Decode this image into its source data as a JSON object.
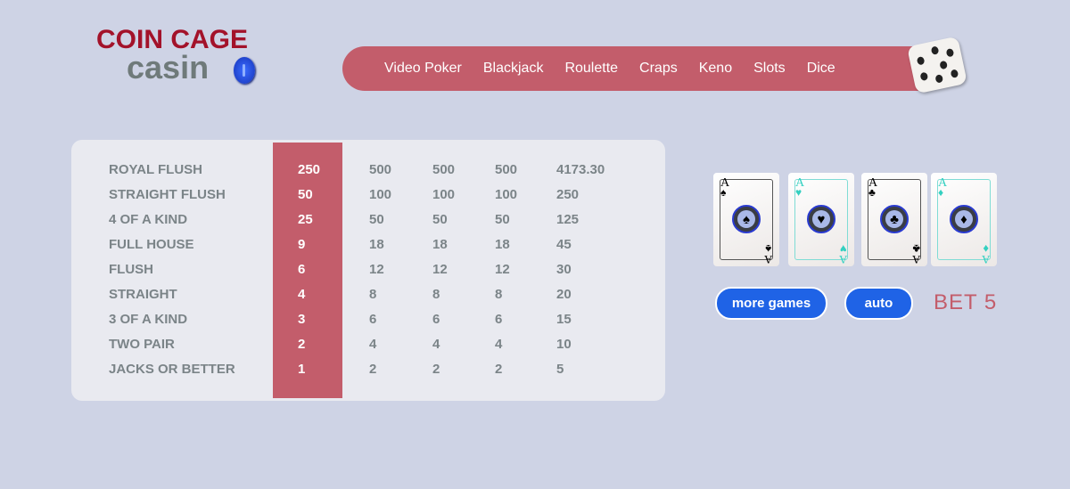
{
  "logo": {
    "line1": "COIN CAGE",
    "line2": "casin"
  },
  "nav": [
    "Video Poker",
    "Blackjack",
    "Roulette",
    "Craps",
    "Keno",
    "Slots",
    "Dice"
  ],
  "paytable": [
    [
      "ROYAL FLUSH",
      "250",
      "500",
      "500",
      "500",
      "4173.30"
    ],
    [
      "STRAIGHT FLUSH",
      "50",
      "100",
      "100",
      "100",
      "250"
    ],
    [
      "4 OF A KIND",
      "25",
      "50",
      "50",
      "50",
      "125"
    ],
    [
      "FULL HOUSE",
      "9",
      "18",
      "18",
      "18",
      "45"
    ],
    [
      "FLUSH",
      "6",
      "12",
      "12",
      "12",
      "30"
    ],
    [
      "STRAIGHT",
      "4",
      "8",
      "8",
      "8",
      "20"
    ],
    [
      "3 OF A KIND",
      "3",
      "6",
      "6",
      "6",
      "15"
    ],
    [
      "TWO PAIR",
      "2",
      "4",
      "4",
      "4",
      "10"
    ],
    [
      "JACKS OR BETTER",
      "1",
      "2",
      "2",
      "2",
      "5"
    ]
  ],
  "cards": [
    {
      "rank": "A",
      "suit": "♠",
      "color": "dark"
    },
    {
      "rank": "A",
      "suit": "♥",
      "color": "teal"
    },
    {
      "rank": "A",
      "suit": "♣",
      "color": "dark"
    },
    {
      "rank": "A",
      "suit": "♦",
      "color": "teal"
    }
  ],
  "buttons": {
    "more_games": "more games",
    "auto": "auto"
  },
  "bet": "BET 5"
}
